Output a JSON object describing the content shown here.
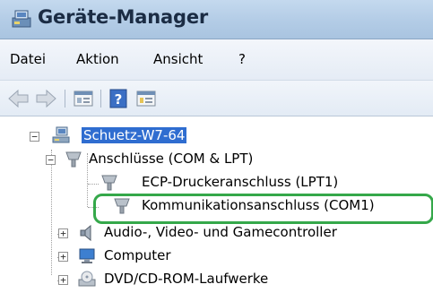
{
  "window": {
    "title": "Geräte-Manager",
    "title_icon": "device-manager-icon"
  },
  "menu": [
    "Datei",
    "Aktion",
    "Ansicht",
    "?"
  ],
  "toolbar": {
    "icons": [
      "back-arrow-icon",
      "forward-arrow-icon",
      "properties-icon",
      "help-icon",
      "view-icon"
    ]
  },
  "tree": {
    "root": {
      "label": "Schuetz-W7-64",
      "icon": "computer-network-icon"
    },
    "items": [
      {
        "label": "Anschlüsse (COM & LPT)",
        "icon": "port-icon"
      },
      {
        "label": "ECP-Druckeranschluss (LPT1)",
        "icon": "port-icon"
      },
      {
        "label": "Kommunikationsanschluss (COM1)",
        "icon": "port-icon"
      },
      {
        "label": "Audio-, Video- und Gamecontroller",
        "icon": "speaker-icon"
      },
      {
        "label": "Computer",
        "icon": "computer-icon"
      },
      {
        "label": "DVD/CD-ROM-Laufwerke",
        "icon": "dvd-drive-icon"
      }
    ]
  },
  "colors": {
    "selection": "#2f6dd0",
    "highlight_ring": "#35a84a"
  }
}
